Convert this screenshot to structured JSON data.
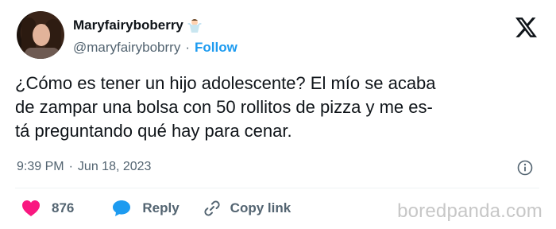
{
  "user": {
    "display_name": "Maryfairyboberry",
    "handle": "@maryfairybobrry",
    "separator": "·",
    "follow_label": "Follow",
    "badge_emoji": "fairy-emoji"
  },
  "tweet": {
    "text": "¿Cómo es tener un hijo adolescente? El mío se acaba\nde zampar una bolsa con 50 rollitos de pizza y me es-\ntá preguntando qué hay para cenar.",
    "time": "9:39 PM",
    "date_separator": "·",
    "date": "Jun 18, 2023"
  },
  "actions": {
    "like_count": "876",
    "reply_label": "Reply",
    "copy_label": "Copy link"
  },
  "watermark": "boredpanda.com",
  "colors": {
    "link": "#1d9bf0",
    "like": "#f91880",
    "reply_icon": "#1d9bf0",
    "muted": "#536471",
    "text": "#0f1419"
  }
}
